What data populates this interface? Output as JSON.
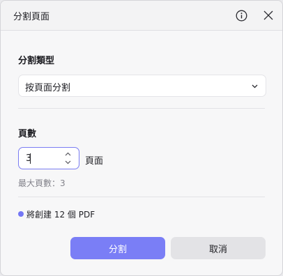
{
  "dialog": {
    "title": "分割頁面",
    "info_icon": "info-circle-icon",
    "close_icon": "close-icon"
  },
  "split_type": {
    "label": "分割類型",
    "selected": "按頁面分割",
    "chevron_icon": "chevron-down-icon"
  },
  "pages": {
    "label": "頁數",
    "value": "3",
    "unit": "頁面",
    "max_text": "最大頁數：3"
  },
  "result": {
    "text": "將創建 12 個 PDF"
  },
  "buttons": {
    "split": "分割",
    "cancel": "取消"
  },
  "colors": {
    "accent": "#7a7ef6",
    "dot": "#7477f5",
    "secondary_button": "#e3e3e6"
  }
}
